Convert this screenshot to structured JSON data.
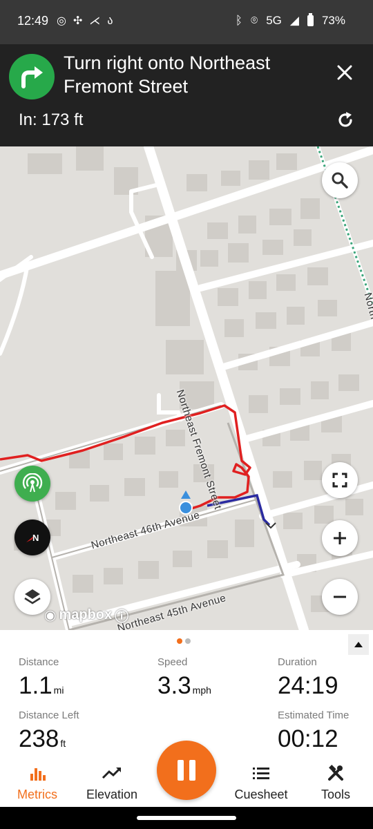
{
  "status_bar": {
    "time": "12:49",
    "network": "5G",
    "battery": "73%",
    "left_icons": [
      "whatsapp-icon",
      "slack-icon",
      "strava-icon",
      "cycling-icon"
    ],
    "right_icons": [
      "bluetooth-icon",
      "location-icon",
      "signal-icon",
      "battery-icon"
    ]
  },
  "navigation": {
    "instruction": "Turn right onto Northeast Fremont Street",
    "distance_text": "In: 173 ft",
    "turn_icon": "turn-right-icon",
    "accent_color": "#27a94a"
  },
  "map": {
    "streets": {
      "fremont": "Northeast Fremont Street",
      "ave46": "Northeast 46th Avenue",
      "ave45": "Northeast 45th Avenue",
      "partial_right": "North"
    },
    "attribution": "mapbox",
    "route_color": "#e02020",
    "path_color": "#2a2aa0"
  },
  "metrics": {
    "page_indicator": {
      "pages": 2,
      "active": 1
    },
    "items": [
      {
        "label": "Distance",
        "value": "1.1",
        "unit": "mi"
      },
      {
        "label": "Speed",
        "value": "3.3",
        "unit": "mph"
      },
      {
        "label": "Duration",
        "value": "24:19",
        "unit": ""
      },
      {
        "label": "Distance Left",
        "value": "238",
        "unit": "ft"
      },
      {
        "label": "Estimated Time",
        "value": "00:12",
        "unit": ""
      }
    ]
  },
  "bottom_nav": {
    "items": [
      {
        "label": "Metrics",
        "icon": "bar-chart-icon",
        "active": true
      },
      {
        "label": "Elevation",
        "icon": "trend-icon",
        "active": false
      },
      {
        "label": "Cuesheet",
        "icon": "list-icon",
        "active": false
      },
      {
        "label": "Tools",
        "icon": "tools-icon",
        "active": false
      }
    ],
    "accent_color": "#f26f1c"
  }
}
